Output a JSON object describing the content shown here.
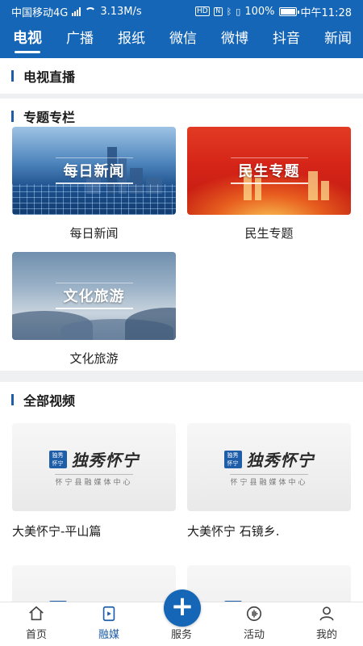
{
  "status_bar": {
    "carrier": "中国移动4G",
    "network_speed": "3.13M/s",
    "hd": "HD",
    "battery": "100%",
    "time": "中午11:28"
  },
  "tabs": [
    "电视",
    "广播",
    "报纸",
    "微信",
    "微博",
    "抖音",
    "新闻"
  ],
  "active_tab": "电视",
  "sections": {
    "live": "电视直播",
    "special": "专题专栏",
    "all_videos": "全部视频"
  },
  "special_items": [
    {
      "thumb_text": "每日新闻",
      "caption": "每日新闻"
    },
    {
      "thumb_text": "民生专题",
      "caption": "民生专题"
    },
    {
      "thumb_text": "文化旅游",
      "caption": "文化旅游"
    }
  ],
  "video_brand": {
    "logo_text": "独秀怀宁",
    "brand": "独秀怀宁",
    "sub": "怀宁县融媒体中心"
  },
  "videos": [
    {
      "caption": "大美怀宁-平山篇"
    },
    {
      "caption": "大美怀宁 石镜乡."
    }
  ],
  "bottom_nav": [
    {
      "label": "首页",
      "icon": "home-icon"
    },
    {
      "label": "融媒",
      "icon": "media-icon"
    },
    {
      "label": "服务",
      "icon": "plus-icon"
    },
    {
      "label": "活动",
      "icon": "activity-icon"
    },
    {
      "label": "我的",
      "icon": "user-icon"
    }
  ],
  "colors": {
    "primary": "#1566b6",
    "accent_bar": "#1e5da8"
  }
}
